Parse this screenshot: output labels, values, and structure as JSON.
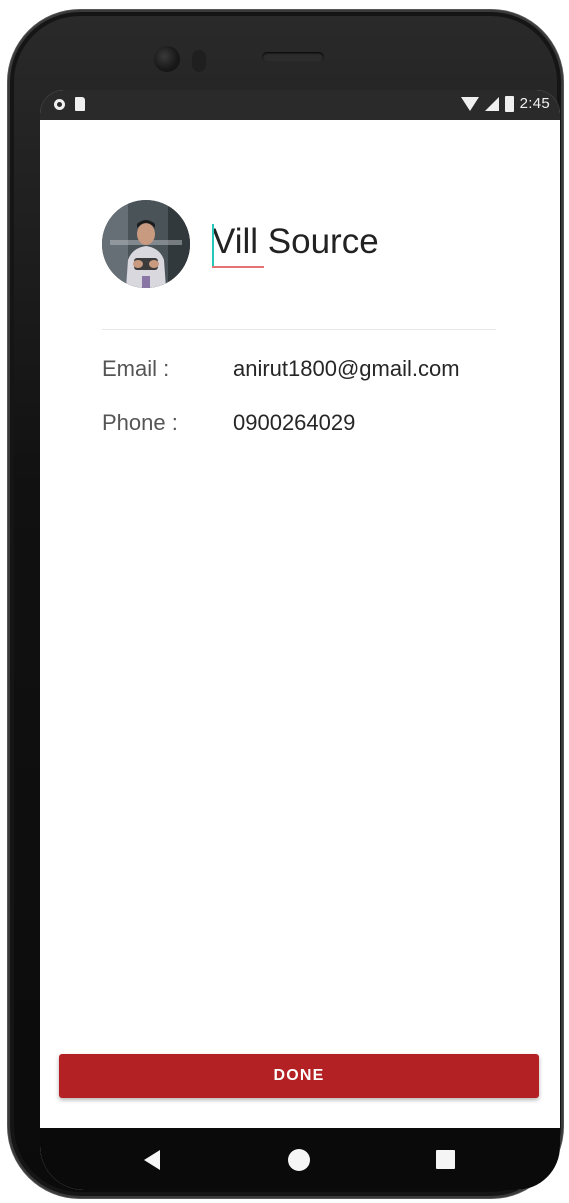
{
  "status_bar": {
    "time": "2:45",
    "icons": [
      "sync-icon",
      "sd-card-icon",
      "wifi-icon",
      "signal-icon",
      "battery-icon"
    ]
  },
  "profile": {
    "avatar_icon": "user-avatar-photo",
    "name": "Vill Source"
  },
  "details": {
    "email_label": "Email :",
    "email_value": "anirut1800@gmail.com",
    "phone_label": "Phone :",
    "phone_value": "0900264029"
  },
  "actions": {
    "done_label": "DONE"
  },
  "nav": {
    "icons": [
      "back-icon",
      "home-icon",
      "recents-icon"
    ]
  },
  "colors": {
    "accent": "#b32124",
    "caret": "#26c6b8",
    "spellcheck_underline": "#e57373"
  }
}
